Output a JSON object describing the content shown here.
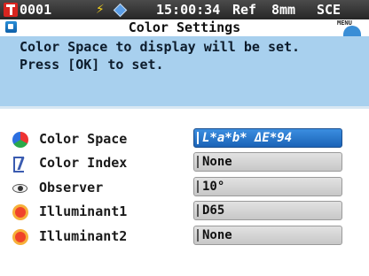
{
  "status": {
    "sample_id": "0001",
    "time": "15:00:34",
    "ref": "Ref",
    "aperture": "8mm",
    "mode": "SCE"
  },
  "title": "Color Settings",
  "menu_label": "MENU",
  "message": {
    "line1": "Color Space to display will be set.",
    "line2": "Press [OK] to set."
  },
  "settings": [
    {
      "label": "Color Space",
      "value": "L*a*b* ΔE*94",
      "icon": "color-space-icon",
      "selected": true
    },
    {
      "label": "Color Index",
      "value": "None",
      "icon": "color-index-icon",
      "selected": false
    },
    {
      "label": "Observer",
      "value": "10°",
      "icon": "observer-eye-icon",
      "selected": false
    },
    {
      "label": "Illuminant1",
      "value": "D65",
      "icon": "illuminant-sun-icon",
      "selected": false
    },
    {
      "label": "Illuminant2",
      "value": "None",
      "icon": "illuminant-sun-icon",
      "selected": false
    }
  ],
  "colors": {
    "status_bar": "#2f2f2f",
    "message_bg": "#a8d0ee",
    "selected_value": "#2f7fd2",
    "value_box": "#d4d4d4"
  }
}
